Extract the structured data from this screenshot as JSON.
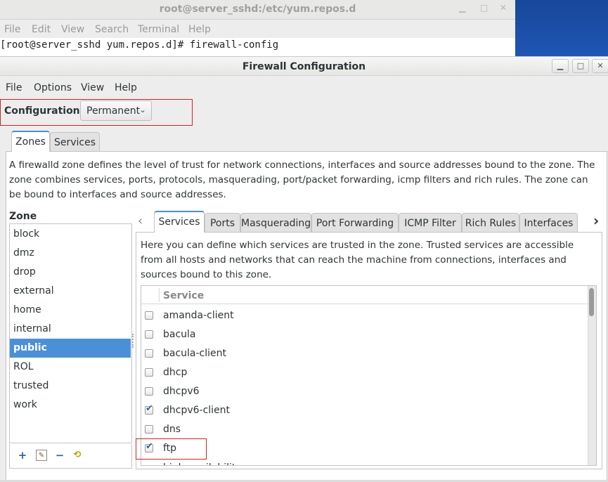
{
  "terminal": {
    "title": "root@server_sshd:/etc/yum.repos.d",
    "menu": [
      "File",
      "Edit",
      "View",
      "Search",
      "Terminal",
      "Help"
    ],
    "prompt_line": "[root@server_sshd yum.repos.d]# firewall-config"
  },
  "window": {
    "title": "Firewall Configuration",
    "menu": [
      "File",
      "Options",
      "View",
      "Help"
    ]
  },
  "configuration": {
    "label": "Configuration:",
    "selected": "Permanent"
  },
  "top_tabs": [
    "Zones",
    "Services"
  ],
  "zones": {
    "description": "A firewalld zone defines the level of trust for network connections, interfaces and source addresses bound to the zone. The zone combines services, ports, protocols, masquerading, port/packet forwarding, icmp filters and rich rules. The zone can be bound to interfaces and source addresses.",
    "header": "Zone",
    "items": [
      "block",
      "dmz",
      "drop",
      "external",
      "home",
      "internal",
      "public",
      "ROL",
      "trusted",
      "work"
    ],
    "selected": "public"
  },
  "inner_tabs": [
    "Services",
    "Ports",
    "Masquerading",
    "Port Forwarding",
    "ICMP Filter",
    "Rich Rules",
    "Interfaces"
  ],
  "services": {
    "description": "Here you can define which services are trusted in the zone. Trusted services are accessible from all hosts and networks that can reach the machine from connections, interfaces and sources bound to this zone.",
    "column": "Service",
    "rows": [
      {
        "name": "amanda-client",
        "checked": false
      },
      {
        "name": "bacula",
        "checked": false
      },
      {
        "name": "bacula-client",
        "checked": false
      },
      {
        "name": "dhcp",
        "checked": false
      },
      {
        "name": "dhcpv6",
        "checked": false
      },
      {
        "name": "dhcpv6-client",
        "checked": true
      },
      {
        "name": "dns",
        "checked": false
      },
      {
        "name": "ftp",
        "checked": true
      }
    ],
    "partial_row": "high-availability"
  },
  "colors": {
    "accent": "#4a90d9",
    "highlight_box": "#d62020"
  }
}
